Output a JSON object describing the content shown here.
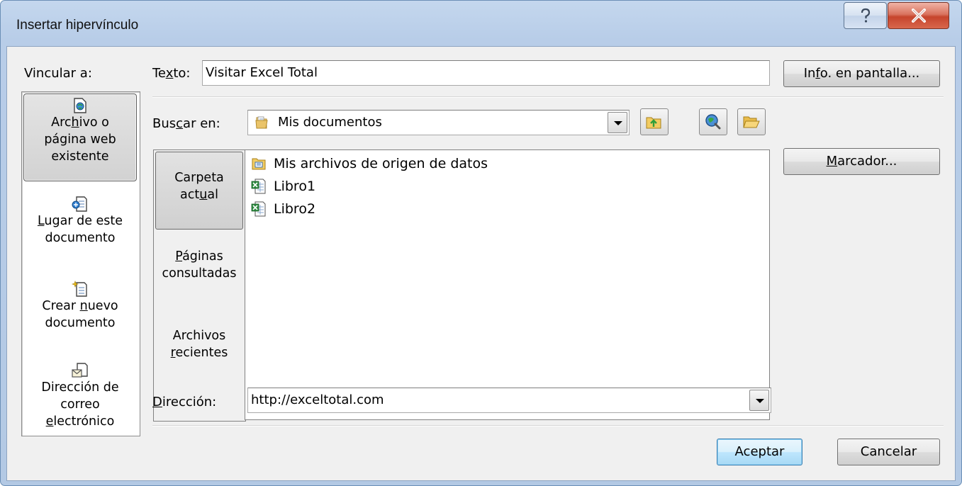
{
  "window": {
    "title": "Insertar hipervínculo",
    "help_glyph": "?",
    "close_glyph": "X"
  },
  "link_to": {
    "label": "Vincular a:",
    "items": [
      {
        "label_html": "Arc<u>h</u>ivo o<br>página web<br>existente",
        "icon": "existing-file-icon",
        "selected": true
      },
      {
        "label_html": "<u>L</u>ugar de este<br>documento",
        "icon": "place-in-document-icon",
        "selected": false
      },
      {
        "label_html": "Crear <u>n</u>uevo<br>documento",
        "icon": "new-document-icon",
        "selected": false
      },
      {
        "label_html": "Dirección de<br>correo<br><u>e</u>lectrónico",
        "icon": "email-address-icon",
        "selected": false
      }
    ]
  },
  "text": {
    "label_html": "Te<u>x</u>to:",
    "value": "Visitar Excel Total"
  },
  "screentip_button_html": "In<u>f</u>o. en pantalla...",
  "look_in": {
    "label_html": "Bus<u>c</u>ar en:",
    "value": "Mis documentos"
  },
  "places": [
    {
      "label_html": "Carpeta<br>act<u>u</u>al",
      "selected": true
    },
    {
      "label_html": "<u>P</u>áginas<br>consultadas",
      "selected": false
    },
    {
      "label_html": "Archivos<br><u>r</u>ecientes",
      "selected": false
    }
  ],
  "files": [
    {
      "name": "Mis archivos de origen de datos",
      "icon": "data-source-folder-icon"
    },
    {
      "name": "Libro1",
      "icon": "excel-file-icon"
    },
    {
      "name": "Libro2",
      "icon": "excel-file-icon"
    }
  ],
  "bookmark_button_html": "<u>M</u>arcador...",
  "address": {
    "label_html": "<u>D</u>irección:",
    "value": "http://exceltotal.com"
  },
  "buttons": {
    "ok": "Aceptar",
    "cancel": "Cancelar"
  }
}
